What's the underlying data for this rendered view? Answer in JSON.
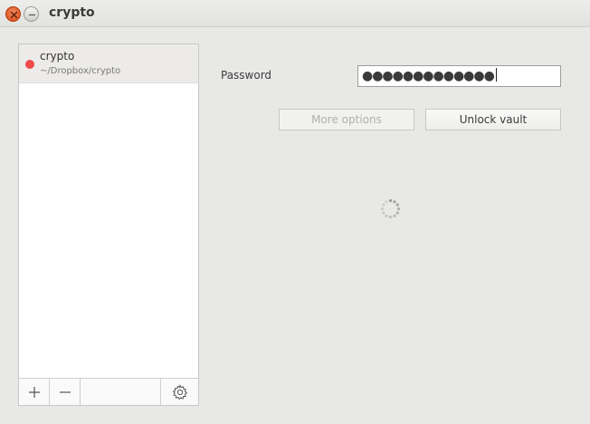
{
  "window": {
    "title": "crypto",
    "close_icon": "close-icon",
    "minimize_icon": "minimize-icon"
  },
  "vaults": [
    {
      "name": "crypto",
      "path": "~/Dropbox/crypto",
      "status": "locked",
      "status_color": "#ee4a4a"
    }
  ],
  "toolbar": {
    "add_icon": "plus-icon",
    "remove_icon": "minus-icon",
    "settings_icon": "gear-icon"
  },
  "unlock": {
    "password_label": "Password",
    "password_value": "●●●●●●●●●●●●●",
    "more_options_label": "More options",
    "more_options_enabled": false,
    "unlock_label": "Unlock vault",
    "loading": true
  }
}
